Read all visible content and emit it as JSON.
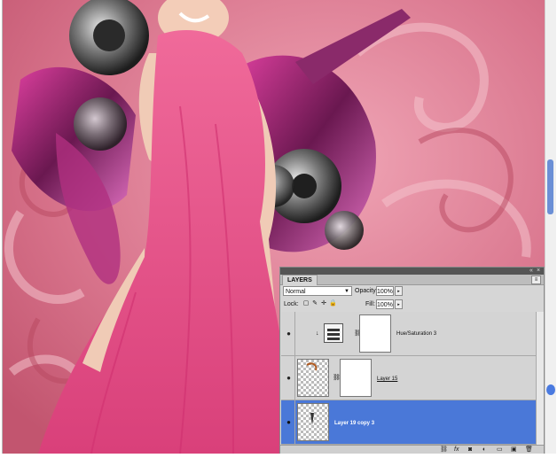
{
  "panel": {
    "title": "LAYERS",
    "blend_mode": "Normal",
    "opacity_label": "Opacity:",
    "opacity_value": "100%",
    "lock_label": "Lock:",
    "fill_label": "Fill:",
    "fill_value": "100%"
  },
  "layers": [
    {
      "name": "Hue/Saturation 3",
      "type": "adjustment",
      "visible": true,
      "selected": false
    },
    {
      "name": "Layer 15",
      "type": "pixel-with-mask",
      "visible": true,
      "selected": false
    },
    {
      "name": "Layer 19 copy 3",
      "type": "pixel",
      "visible": true,
      "selected": true
    }
  ],
  "icons": {
    "eye": "eye-icon",
    "link": "link-layers-icon",
    "fx": "fx-icon",
    "mask": "add-mask-icon",
    "adjust": "new-adjustment-icon",
    "group": "new-group-icon",
    "new": "new-layer-icon",
    "trash": "delete-layer-icon"
  },
  "colors": {
    "selected_row": "#4a78d8",
    "canvas_pink": "#d4607a",
    "dress_pink": "#e8508a"
  }
}
